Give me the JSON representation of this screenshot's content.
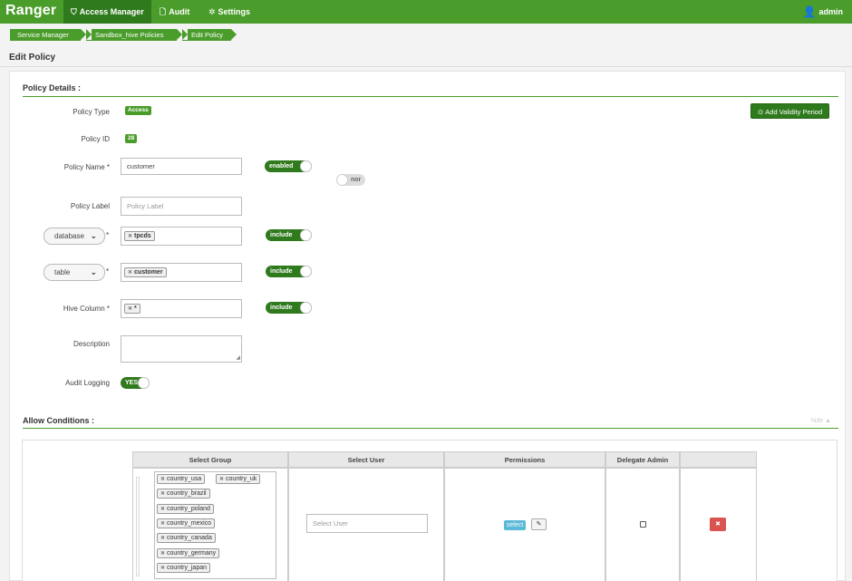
{
  "nav": {
    "brand": "Ranger",
    "items": [
      {
        "label": "Access Manager",
        "icon": "shield-icon"
      },
      {
        "label": "Audit",
        "icon": "file-icon"
      },
      {
        "label": "Settings",
        "icon": "gear-icon"
      }
    ],
    "user": "admin"
  },
  "breadcrumb": [
    "Service Manager",
    "Sandbox_hive Policies",
    "Edit Policy"
  ],
  "page_title": "Edit Policy",
  "policy_details": {
    "title": "Policy Details :",
    "policy_type_label": "Policy Type",
    "policy_type_value": "Access",
    "policy_id_label": "Policy ID",
    "policy_id_value": "28",
    "add_validity_label": "Add Validity Period",
    "policy_name_label": "Policy Name *",
    "policy_name_value": "customer",
    "enabled_toggle": "enabled",
    "normal_toggle": "nor",
    "policy_label_label": "Policy Label",
    "policy_label_placeholder": "Policy Label",
    "database_select": "database",
    "database_tag": "tpcds",
    "table_select": "table",
    "table_tag": "customer",
    "hive_column_label": "Hive Column *",
    "hive_column_tag": "*",
    "include_label": "include",
    "required_star": "*",
    "description_label": "Description",
    "audit_logging_label": "Audit Logging",
    "audit_logging_toggle": "YES"
  },
  "allow_conditions": {
    "title": "Allow Conditions :",
    "hide_link": "hide ▲",
    "columns": [
      "Select Group",
      "Select User",
      "Permissions",
      "Delegate Admin"
    ],
    "groups": [
      "country_usa",
      "country_uk",
      "country_brazil",
      "country_poland",
      "country_mexico",
      "country_canada",
      "country_germany",
      "country_japan"
    ],
    "user_placeholder": "Select User",
    "permission_badge": "select"
  }
}
